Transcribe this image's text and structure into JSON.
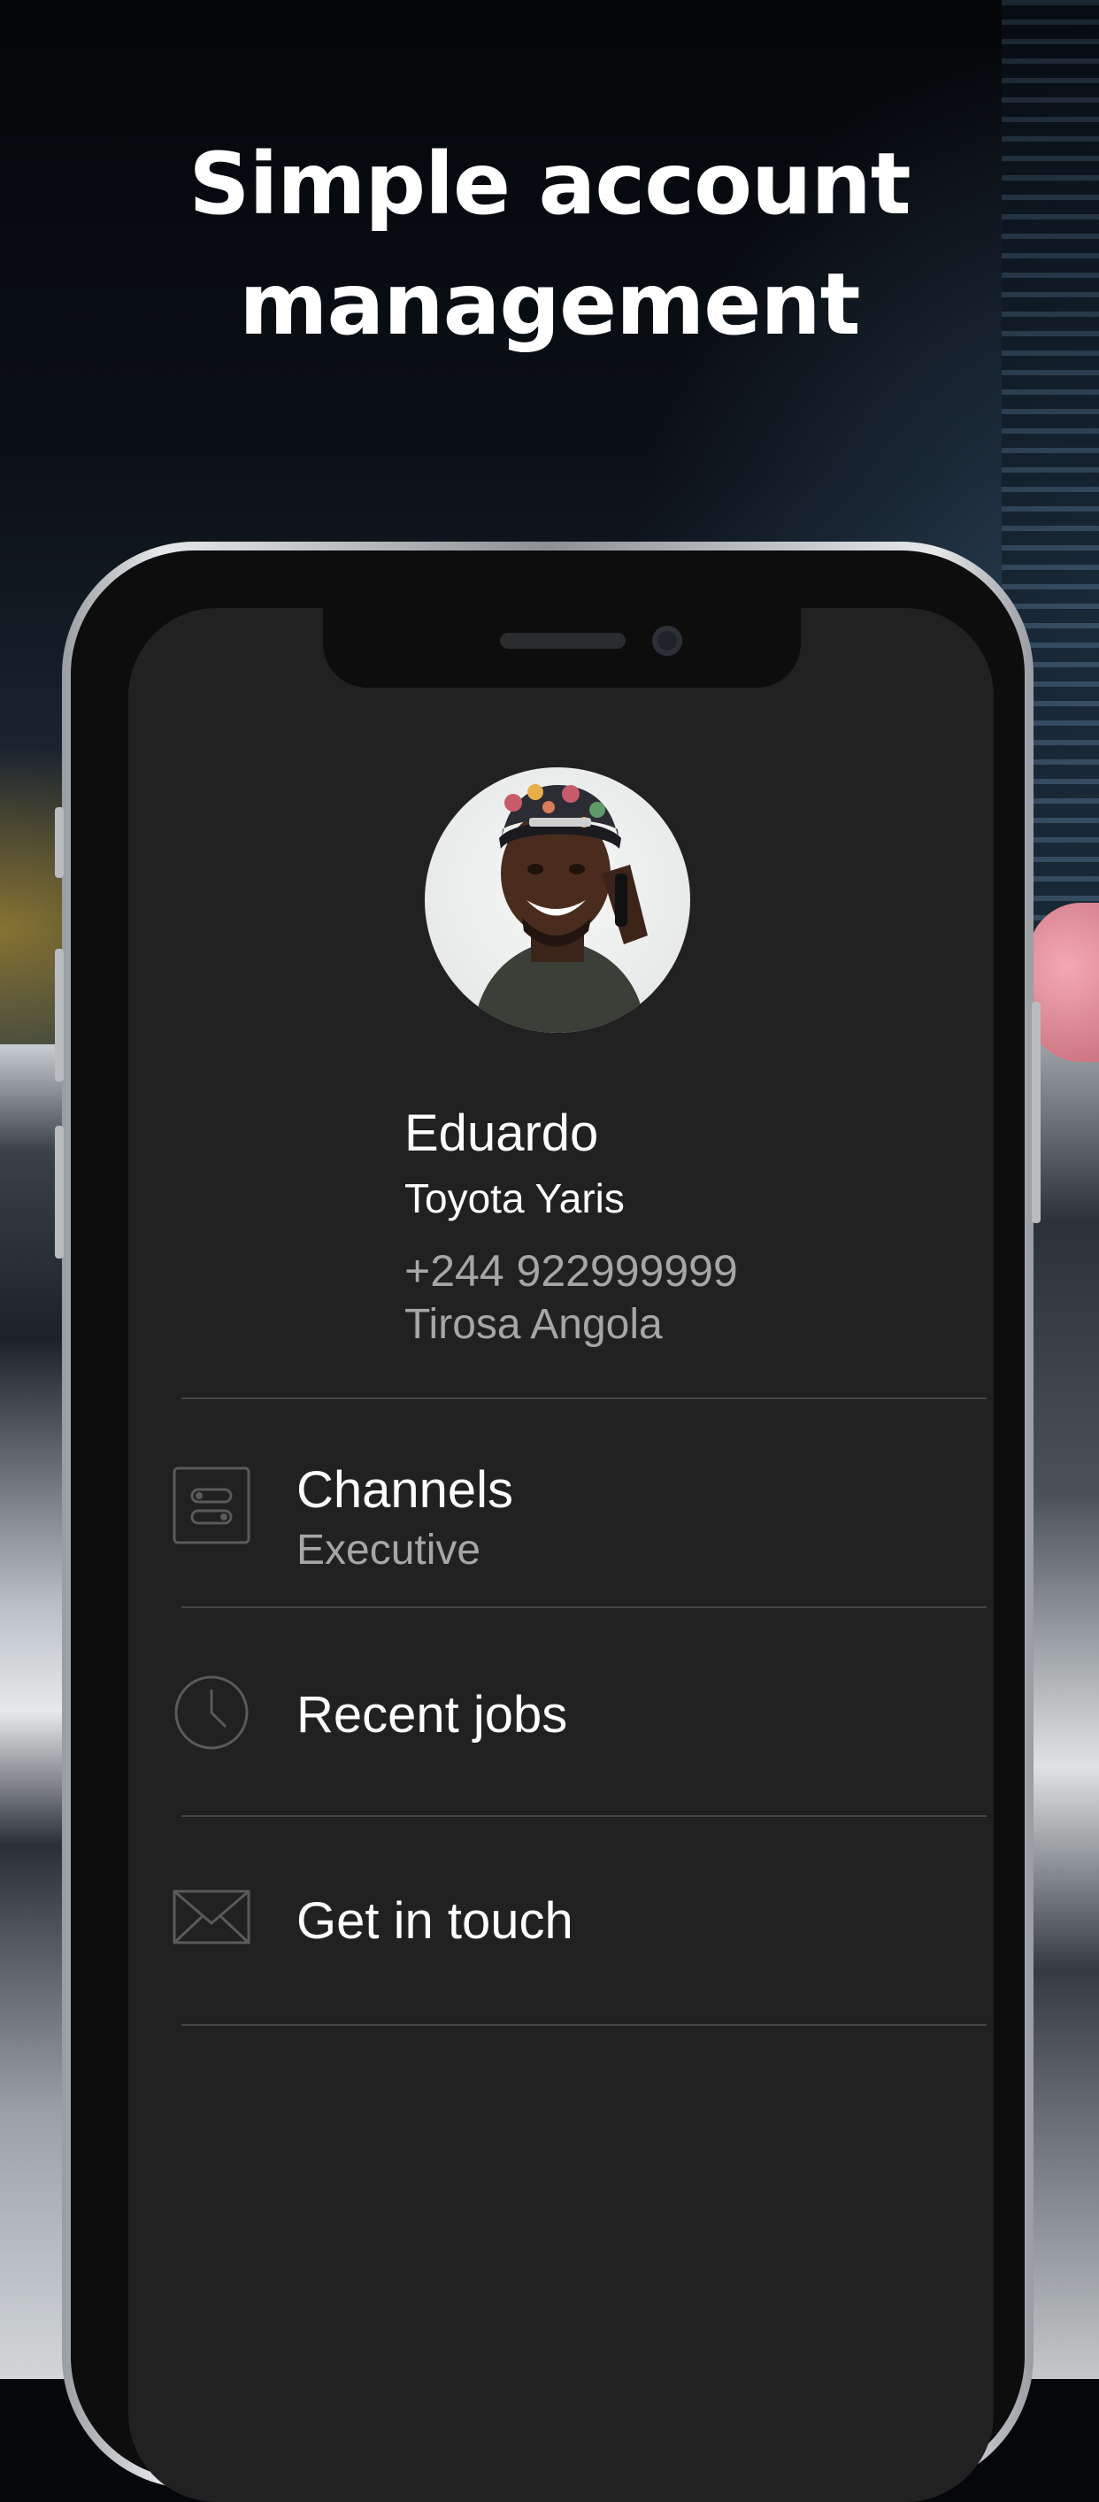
{
  "headline": {
    "line1": "Simple account",
    "line2": "management"
  },
  "profile": {
    "name": "Eduardo",
    "car": "Toyota Yaris",
    "phone": "+244 922999999",
    "location": "Tirosa Angola"
  },
  "menu": [
    {
      "label": "Channels",
      "sublabel": "Executive",
      "icon": "toggles-icon"
    },
    {
      "label": "Recent jobs",
      "icon": "clock-icon"
    },
    {
      "label": "Get in touch",
      "icon": "mail-icon"
    }
  ],
  "colors": {
    "screen_bg": "#212121",
    "primary_text": "#ffffff",
    "secondary_text": "#a6a6a6",
    "divider": "#454545"
  }
}
